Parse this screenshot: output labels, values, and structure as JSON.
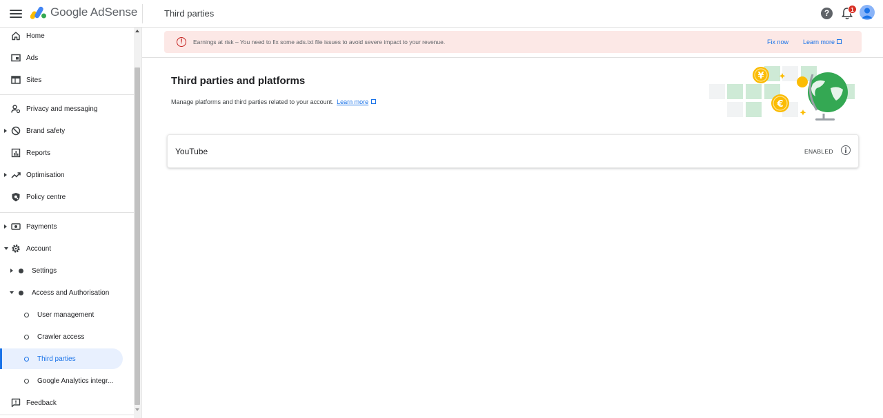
{
  "header": {
    "app_name": "Google AdSense",
    "page_title": "Third parties",
    "help_glyph": "?",
    "notification_count": "1",
    "icons": [
      "menu-icon",
      "adsense-logo",
      "help-icon",
      "bell-icon",
      "avatar"
    ]
  },
  "sidebar": {
    "items": [
      {
        "label": "Home",
        "icon": "home-icon"
      },
      {
        "label": "Ads",
        "icon": "ads-icon"
      },
      {
        "label": "Sites",
        "icon": "sites-icon"
      },
      {
        "label": "Privacy and messaging",
        "icon": "privacy-icon"
      },
      {
        "label": "Brand safety",
        "icon": "block-icon"
      },
      {
        "label": "Reports",
        "icon": "reports-icon"
      },
      {
        "label": "Optimisation",
        "icon": "trending-icon"
      },
      {
        "label": "Policy centre",
        "icon": "policy-shield-icon"
      },
      {
        "label": "Payments",
        "icon": "payments-icon"
      },
      {
        "label": "Account",
        "icon": "gear-icon"
      },
      {
        "label": "Settings"
      },
      {
        "label": "Access and Authorisation"
      },
      {
        "label": "User management"
      },
      {
        "label": "Crawler access"
      },
      {
        "label": "Third parties"
      },
      {
        "label": "Google Analytics integr..."
      },
      {
        "label": "Feedback",
        "icon": "feedback-icon"
      }
    ],
    "active_item": "Third parties"
  },
  "alert": {
    "glyph": "!",
    "text": "Earnings at risk – You need to fix some ads.txt file issues to avoid severe impact to your revenue.",
    "fix_label": "Fix now",
    "learn_label": "Learn more"
  },
  "main": {
    "title": "Third parties and platforms",
    "description": "Manage platforms and third parties related to your account.",
    "learn_more": "Learn more",
    "cards": [
      {
        "title": "YouTube",
        "status": "ENABLED"
      }
    ]
  },
  "colors": {
    "accent": "#1a73e8",
    "alert_bg": "#fce8e6",
    "alert_icon": "#c5221f",
    "active_bg": "#e8f0fe"
  }
}
